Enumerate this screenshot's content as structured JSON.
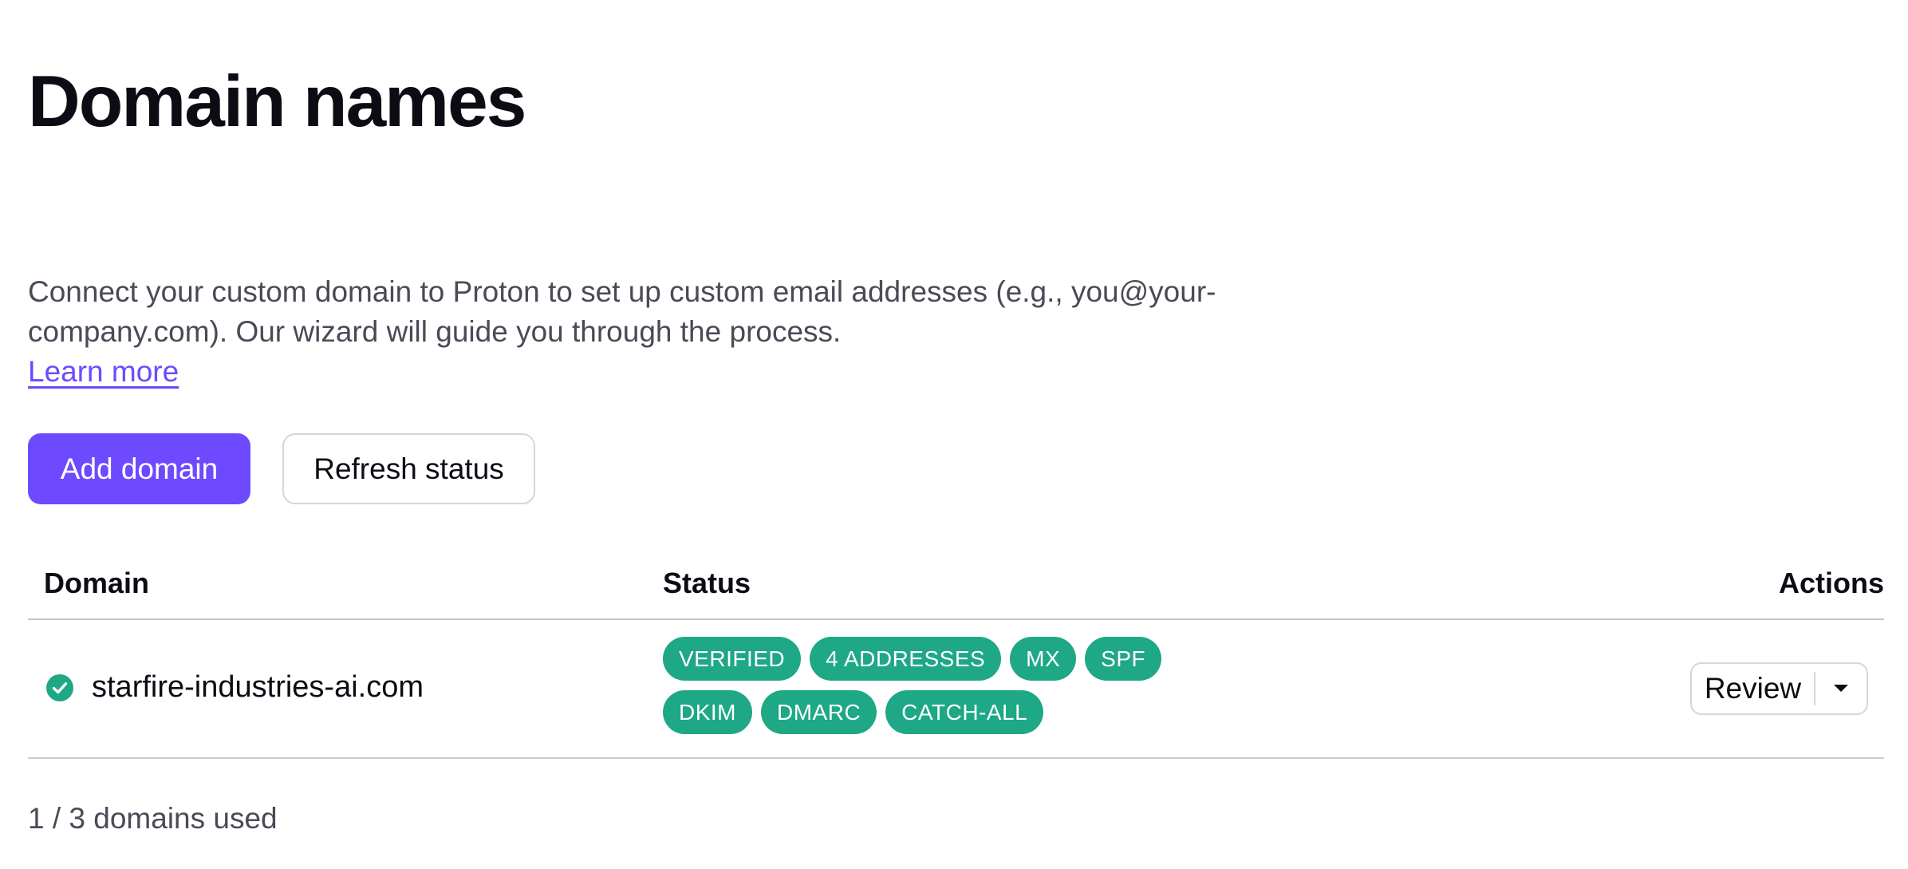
{
  "page": {
    "title": "Domain names",
    "description": "Connect your custom domain to Proton to set up custom email addresses (e.g., you@your-company.com). Our wizard will guide you through the process.",
    "learn_more": "Learn more"
  },
  "buttons": {
    "add_domain": "Add domain",
    "refresh_status": "Refresh status"
  },
  "table": {
    "headers": {
      "domain": "Domain",
      "status": "Status",
      "actions": "Actions"
    },
    "rows": [
      {
        "domain": "starfire-industries-ai.com",
        "status_icon": "check-circle-icon",
        "badges": [
          "VERIFIED",
          "4 ADDRESSES",
          "MX",
          "SPF",
          "DKIM",
          "DMARC",
          "CATCH-ALL"
        ],
        "action": "Review"
      }
    ]
  },
  "usage": "1 / 3 domains used",
  "colors": {
    "accent": "#6d4aff",
    "badge_success": "#1ea885",
    "text_primary": "#0c0c14",
    "text_muted": "#4a4a57",
    "border": "#d6d6da"
  }
}
